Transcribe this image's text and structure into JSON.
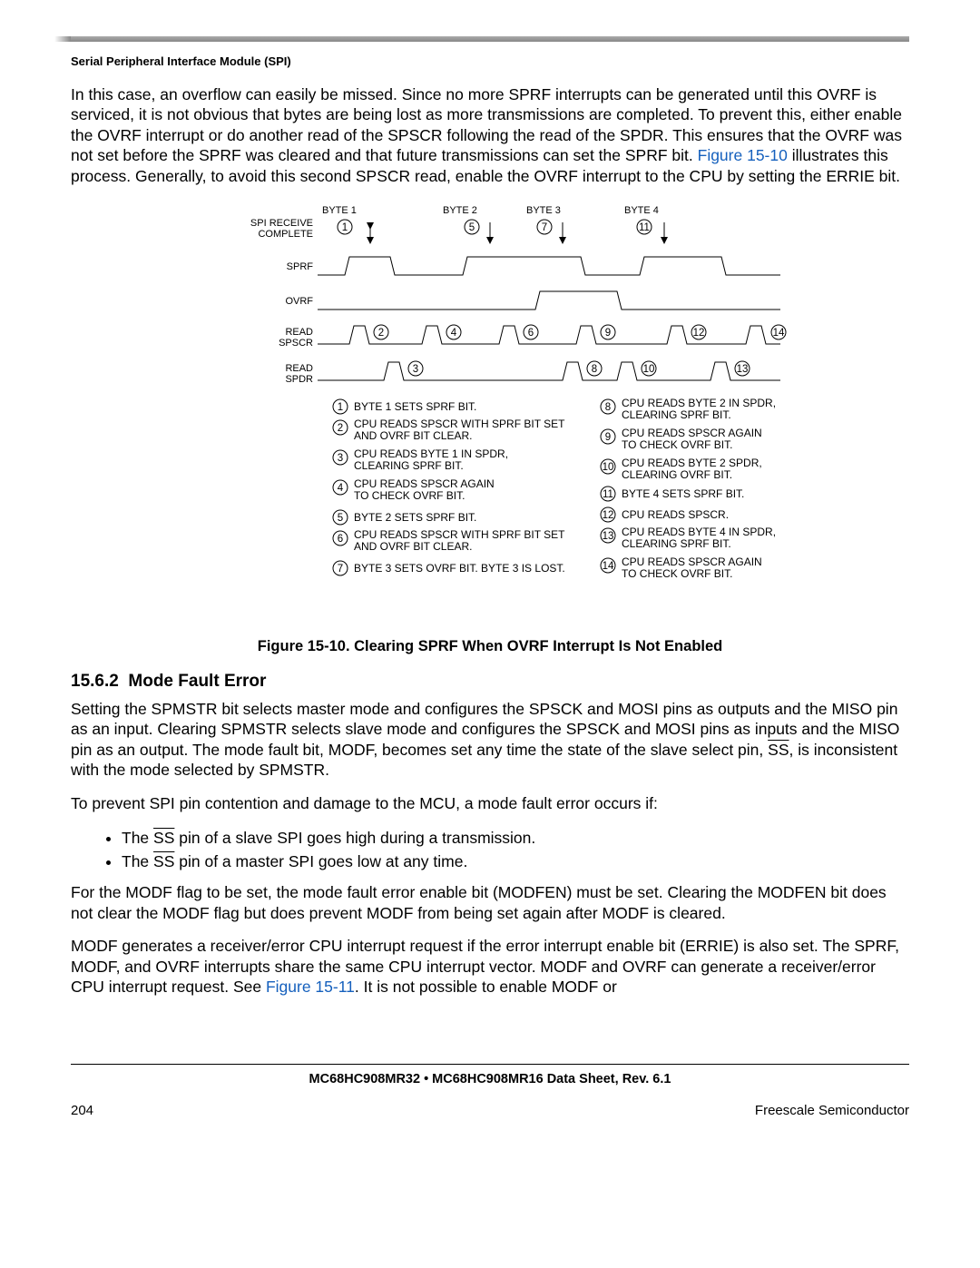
{
  "page": {
    "running_head": "Serial Peripheral Interface Module (SPI)",
    "number": "204",
    "vendor": "Freescale Semiconductor",
    "footer_title": "MC68HC908MR32 • MC68HC908MR16 Data Sheet, Rev. 6.1"
  },
  "para1_a": "In this case, an overflow can easily be missed. Since no more SPRF interrupts can be generated until this OVRF is serviced, it is not obvious that bytes are being lost as more transmissions are completed. To prevent this, either enable the OVRF interrupt or do another read of the SPSCR following the read of the SPDR. This ensures that the OVRF was not set before the SPRF was cleared and that future transmissions can set the SPRF bit. ",
  "para1_link": "Figure 15-10",
  "para1_b": " illustrates this process. Generally, to avoid this second SPSCR read, enable the OVRF interrupt to the CPU by setting the ERRIE bit.",
  "figure": {
    "caption": "Figure 15-10. Clearing SPRF When OVRF Interrupt Is Not Enabled",
    "bytes": [
      "BYTE 1",
      "BYTE 2",
      "BYTE 3",
      "BYTE 4"
    ],
    "spi_receive_a": "SPI RECEIVE",
    "spi_receive_b": "COMPLETE",
    "row_labels": [
      "SPRF",
      "OVRF",
      "READ",
      "SPSCR",
      "READ",
      "SPDR"
    ],
    "numbers_top": [
      "1",
      "5",
      "7",
      "11"
    ],
    "notes_left": [
      "BYTE 1 SETS SPRF BIT.",
      "CPU READS SPSCR WITH SPRF BIT SET AND OVRF BIT CLEAR.",
      "CPU READS BYTE 1 IN SPDR, CLEARING SPRF BIT.",
      "CPU READS SPSCR AGAIN TO CHECK OVRF BIT.",
      "BYTE 2 SETS SPRF BIT.",
      "CPU READS SPSCR WITH SPRF BIT SET AND OVRF BIT CLEAR.",
      "BYTE 3 SETS OVRF BIT. BYTE 3 IS LOST."
    ],
    "notes_right": [
      "CPU READS BYTE 2 IN SPDR, CLEARING SPRF BIT.",
      "CPU READS SPSCR AGAIN TO CHECK OVRF BIT.",
      "CPU READS BYTE 2 SPDR, CLEARING OVRF BIT.",
      "BYTE 4 SETS SPRF BIT.",
      "CPU READS SPSCR.",
      "CPU READS BYTE 4 IN SPDR, CLEARING SPRF BIT.",
      "CPU READS SPSCR AGAIN TO CHECK OVRF BIT."
    ]
  },
  "section": {
    "number": "15.6.2",
    "title": "Mode Fault Error"
  },
  "para2_a": "Setting the SPMSTR bit selects master mode and configures the SPSCK and MOSI pins as outputs and the MISO pin as an input. Clearing SPMSTR selects slave mode and configures the SPSCK and MOSI pins as inputs and the MISO pin as an output. The mode fault bit, MODF, becomes set any time the state of the slave select pin, ",
  "ss": "SS",
  "para2_b": ", is inconsistent with the mode selected by SPMSTR.",
  "para3": "To prevent SPI pin contention and damage to the MCU, a mode fault error occurs if:",
  "bullet1_a": "The ",
  "bullet1_b": " pin of a slave SPI goes high during a transmission.",
  "bullet2_a": "The ",
  "bullet2_b": " pin of a master SPI goes low at any time.",
  "para4": "For the MODF flag to be set, the mode fault error enable bit (MODFEN) must be set. Clearing the MODFEN bit does not clear the MODF flag but does prevent MODF from being set again after MODF is cleared.",
  "para5_a": "MODF generates a receiver/error CPU interrupt request if the error interrupt enable bit (ERRIE) is also set. The SPRF, MODF, and OVRF interrupts share the same CPU interrupt vector. MODF and OVRF can generate a receiver/error CPU interrupt request. See ",
  "para5_link": "Figure 15-11",
  "para5_b": ". It is not possible to enable MODF or"
}
